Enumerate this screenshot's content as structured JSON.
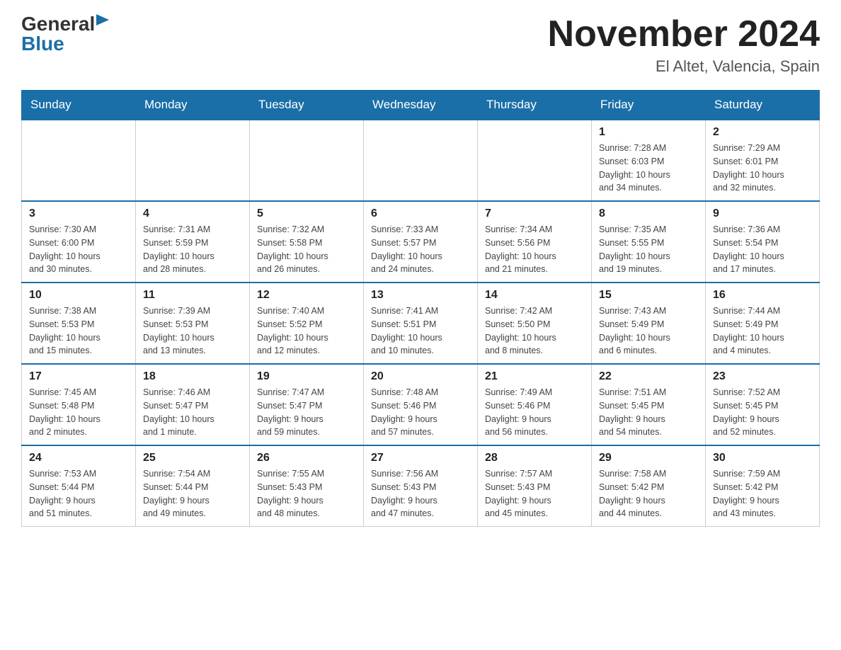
{
  "header": {
    "logo_general": "General",
    "logo_blue": "Blue",
    "month_title": "November 2024",
    "location": "El Altet, Valencia, Spain"
  },
  "days_of_week": [
    "Sunday",
    "Monday",
    "Tuesday",
    "Wednesday",
    "Thursday",
    "Friday",
    "Saturday"
  ],
  "weeks": [
    {
      "days": [
        {
          "number": "",
          "info": ""
        },
        {
          "number": "",
          "info": ""
        },
        {
          "number": "",
          "info": ""
        },
        {
          "number": "",
          "info": ""
        },
        {
          "number": "",
          "info": ""
        },
        {
          "number": "1",
          "info": "Sunrise: 7:28 AM\nSunset: 6:03 PM\nDaylight: 10 hours\nand 34 minutes."
        },
        {
          "number": "2",
          "info": "Sunrise: 7:29 AM\nSunset: 6:01 PM\nDaylight: 10 hours\nand 32 minutes."
        }
      ]
    },
    {
      "days": [
        {
          "number": "3",
          "info": "Sunrise: 7:30 AM\nSunset: 6:00 PM\nDaylight: 10 hours\nand 30 minutes."
        },
        {
          "number": "4",
          "info": "Sunrise: 7:31 AM\nSunset: 5:59 PM\nDaylight: 10 hours\nand 28 minutes."
        },
        {
          "number": "5",
          "info": "Sunrise: 7:32 AM\nSunset: 5:58 PM\nDaylight: 10 hours\nand 26 minutes."
        },
        {
          "number": "6",
          "info": "Sunrise: 7:33 AM\nSunset: 5:57 PM\nDaylight: 10 hours\nand 24 minutes."
        },
        {
          "number": "7",
          "info": "Sunrise: 7:34 AM\nSunset: 5:56 PM\nDaylight: 10 hours\nand 21 minutes."
        },
        {
          "number": "8",
          "info": "Sunrise: 7:35 AM\nSunset: 5:55 PM\nDaylight: 10 hours\nand 19 minutes."
        },
        {
          "number": "9",
          "info": "Sunrise: 7:36 AM\nSunset: 5:54 PM\nDaylight: 10 hours\nand 17 minutes."
        }
      ]
    },
    {
      "days": [
        {
          "number": "10",
          "info": "Sunrise: 7:38 AM\nSunset: 5:53 PM\nDaylight: 10 hours\nand 15 minutes."
        },
        {
          "number": "11",
          "info": "Sunrise: 7:39 AM\nSunset: 5:53 PM\nDaylight: 10 hours\nand 13 minutes."
        },
        {
          "number": "12",
          "info": "Sunrise: 7:40 AM\nSunset: 5:52 PM\nDaylight: 10 hours\nand 12 minutes."
        },
        {
          "number": "13",
          "info": "Sunrise: 7:41 AM\nSunset: 5:51 PM\nDaylight: 10 hours\nand 10 minutes."
        },
        {
          "number": "14",
          "info": "Sunrise: 7:42 AM\nSunset: 5:50 PM\nDaylight: 10 hours\nand 8 minutes."
        },
        {
          "number": "15",
          "info": "Sunrise: 7:43 AM\nSunset: 5:49 PM\nDaylight: 10 hours\nand 6 minutes."
        },
        {
          "number": "16",
          "info": "Sunrise: 7:44 AM\nSunset: 5:49 PM\nDaylight: 10 hours\nand 4 minutes."
        }
      ]
    },
    {
      "days": [
        {
          "number": "17",
          "info": "Sunrise: 7:45 AM\nSunset: 5:48 PM\nDaylight: 10 hours\nand 2 minutes."
        },
        {
          "number": "18",
          "info": "Sunrise: 7:46 AM\nSunset: 5:47 PM\nDaylight: 10 hours\nand 1 minute."
        },
        {
          "number": "19",
          "info": "Sunrise: 7:47 AM\nSunset: 5:47 PM\nDaylight: 9 hours\nand 59 minutes."
        },
        {
          "number": "20",
          "info": "Sunrise: 7:48 AM\nSunset: 5:46 PM\nDaylight: 9 hours\nand 57 minutes."
        },
        {
          "number": "21",
          "info": "Sunrise: 7:49 AM\nSunset: 5:46 PM\nDaylight: 9 hours\nand 56 minutes."
        },
        {
          "number": "22",
          "info": "Sunrise: 7:51 AM\nSunset: 5:45 PM\nDaylight: 9 hours\nand 54 minutes."
        },
        {
          "number": "23",
          "info": "Sunrise: 7:52 AM\nSunset: 5:45 PM\nDaylight: 9 hours\nand 52 minutes."
        }
      ]
    },
    {
      "days": [
        {
          "number": "24",
          "info": "Sunrise: 7:53 AM\nSunset: 5:44 PM\nDaylight: 9 hours\nand 51 minutes."
        },
        {
          "number": "25",
          "info": "Sunrise: 7:54 AM\nSunset: 5:44 PM\nDaylight: 9 hours\nand 49 minutes."
        },
        {
          "number": "26",
          "info": "Sunrise: 7:55 AM\nSunset: 5:43 PM\nDaylight: 9 hours\nand 48 minutes."
        },
        {
          "number": "27",
          "info": "Sunrise: 7:56 AM\nSunset: 5:43 PM\nDaylight: 9 hours\nand 47 minutes."
        },
        {
          "number": "28",
          "info": "Sunrise: 7:57 AM\nSunset: 5:43 PM\nDaylight: 9 hours\nand 45 minutes."
        },
        {
          "number": "29",
          "info": "Sunrise: 7:58 AM\nSunset: 5:42 PM\nDaylight: 9 hours\nand 44 minutes."
        },
        {
          "number": "30",
          "info": "Sunrise: 7:59 AM\nSunset: 5:42 PM\nDaylight: 9 hours\nand 43 minutes."
        }
      ]
    }
  ]
}
